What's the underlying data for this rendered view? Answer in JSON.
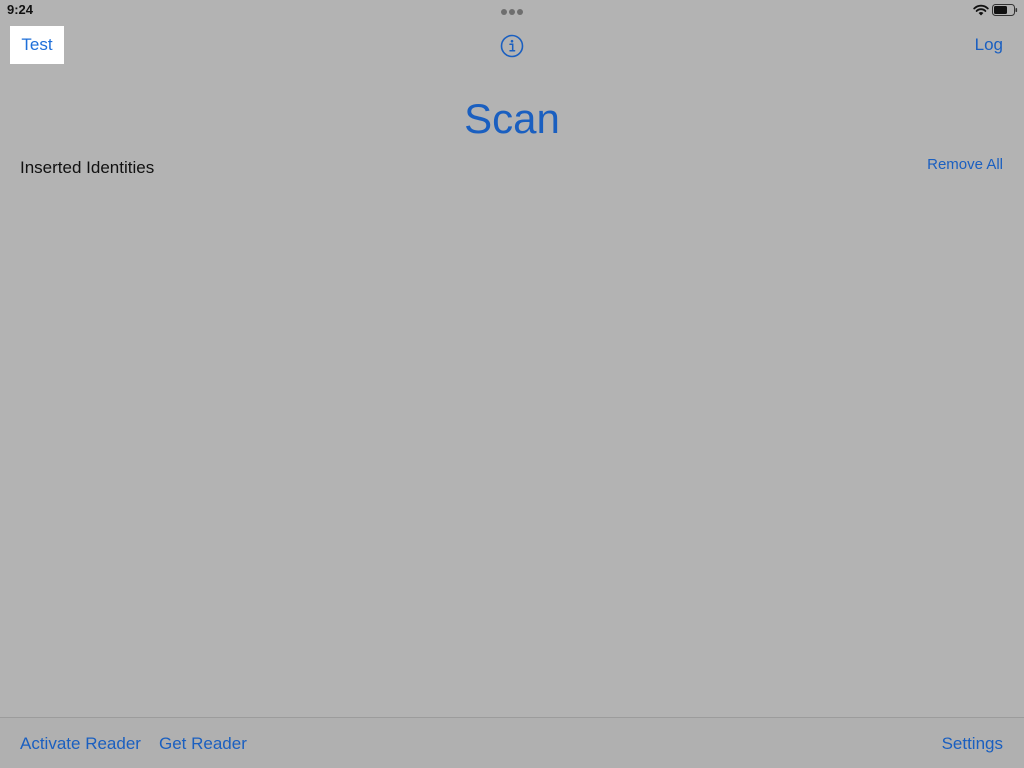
{
  "status_bar": {
    "time": "9:24"
  },
  "nav": {
    "left_button": "Test",
    "center_icon": "info-icon",
    "right_button": "Log"
  },
  "page": {
    "title": "Scan"
  },
  "section": {
    "header": "Inserted Identities",
    "action": "Remove All"
  },
  "toolbar": {
    "activate_reader": "Activate Reader",
    "get_reader": "Get Reader",
    "settings": "Settings"
  },
  "colors": {
    "background": "#b3b3b3",
    "accent": "#1a5fc0",
    "highlight": "#ffffff"
  }
}
